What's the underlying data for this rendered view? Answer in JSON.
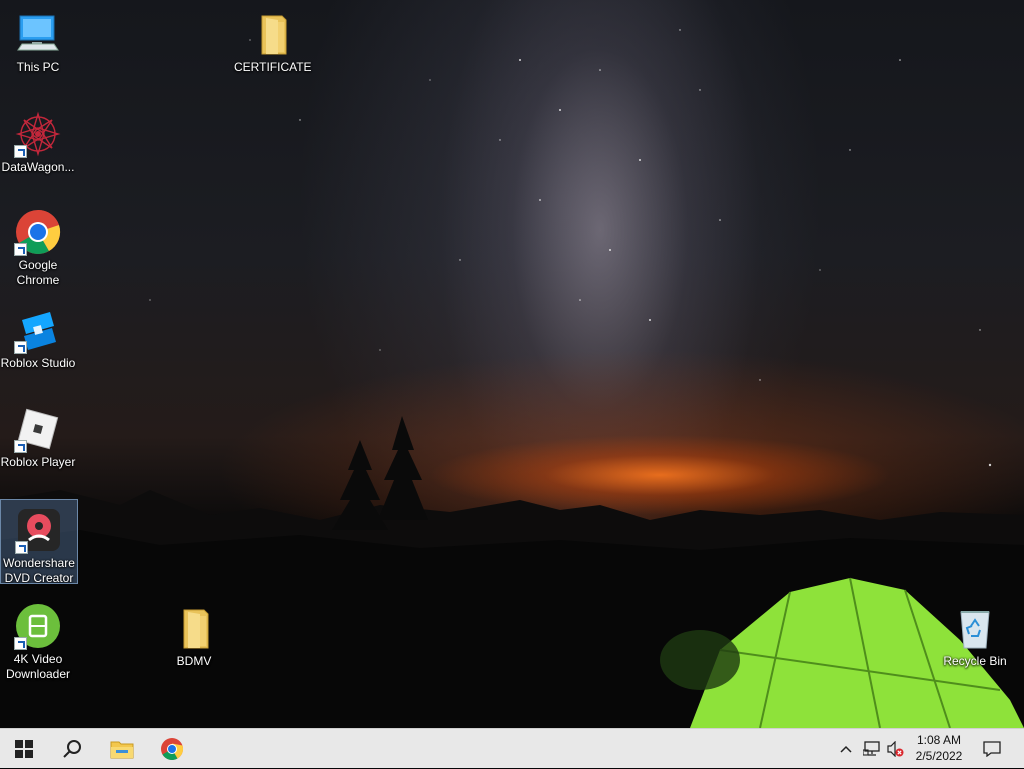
{
  "desktop": {
    "icons": [
      {
        "label": "This PC",
        "icon": "this-pc-icon"
      },
      {
        "label": "CERTIFICATE",
        "icon": "folder-icon"
      },
      {
        "label": "DataWagon...",
        "icon": "datawagon-icon"
      },
      {
        "label": "Google Chrome",
        "icon": "chrome-icon"
      },
      {
        "label": "Roblox Studio",
        "icon": "roblox-studio-icon"
      },
      {
        "label": "Roblox Player",
        "icon": "roblox-player-icon"
      },
      {
        "label": "Wondershare DVD Creator",
        "icon": "wondershare-dvd-icon"
      },
      {
        "label": "4K Video Downloader",
        "icon": "4k-video-downloader-icon"
      },
      {
        "label": "BDMV",
        "icon": "folder-icon"
      },
      {
        "label": "Recycle Bin",
        "icon": "recycle-bin-icon"
      }
    ]
  },
  "taskbar": {
    "start": "windows-start-icon",
    "search": "search-icon",
    "pinned": [
      "file-explorer-icon",
      "chrome-icon"
    ],
    "tray": [
      "chevron-up-icon",
      "network-icon",
      "volume-muted-icon"
    ],
    "clock": {
      "time": "1:08 AM",
      "date": "2/5/2022"
    },
    "notifications": "notification-icon"
  },
  "colors": {
    "taskbar_bg": "#e8e8e8",
    "accent_chrome_blue": "#1a73e8",
    "tent_green": "#8ee23a"
  }
}
